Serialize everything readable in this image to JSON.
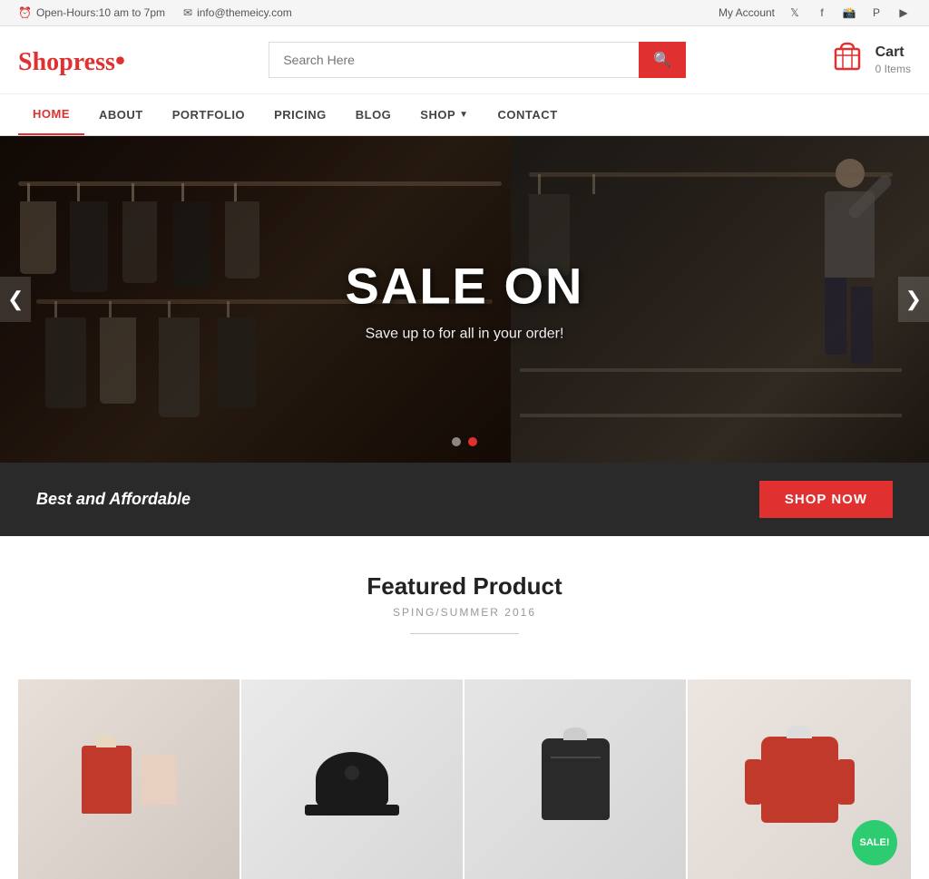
{
  "topbar": {
    "hours_icon": "⏰",
    "hours_text": "Open-Hours:10 am to 7pm",
    "email_icon": "✉",
    "email_text": "info@themeicy.com",
    "account_text": "My Account",
    "social": [
      {
        "name": "twitter",
        "icon": "𝕏"
      },
      {
        "name": "facebook",
        "icon": "f"
      },
      {
        "name": "instagram",
        "icon": "📷"
      },
      {
        "name": "pinterest",
        "icon": "P"
      },
      {
        "name": "youtube",
        "icon": "▶"
      }
    ]
  },
  "header": {
    "logo_main": "Shopress",
    "logo_dot": ".",
    "search_placeholder": "Search Here",
    "cart_label": "Cart",
    "cart_items": "0 Items"
  },
  "nav": {
    "items": [
      {
        "label": "HOME",
        "active": true
      },
      {
        "label": "ABOUT",
        "active": false
      },
      {
        "label": "PORTFOLIO",
        "active": false
      },
      {
        "label": "PRICING",
        "active": false
      },
      {
        "label": "BLOG",
        "active": false
      },
      {
        "label": "SHOP",
        "active": false,
        "has_dropdown": true
      },
      {
        "label": "CONTACT",
        "active": false
      }
    ]
  },
  "hero": {
    "title": "SALE ON",
    "subtitle": "Save up to for all in your order!",
    "dot1_active": false,
    "dot2_active": true
  },
  "promo": {
    "text": "Best and Affordable",
    "btn_label": "Shop Now"
  },
  "featured": {
    "title": "Featured Product",
    "subtitle": "SPING/SUMMER 2016"
  },
  "products": [
    {
      "id": 1,
      "bg": "prod1",
      "has_sale": false
    },
    {
      "id": 2,
      "bg": "prod2",
      "has_sale": false
    },
    {
      "id": 3,
      "bg": "prod3",
      "has_sale": false
    },
    {
      "id": 4,
      "bg": "prod4",
      "has_sale": true,
      "sale_label": "SALE!"
    }
  ],
  "colors": {
    "primary": "#e03030",
    "dark": "#2a2a2a",
    "accent_green": "#2ecc71"
  }
}
